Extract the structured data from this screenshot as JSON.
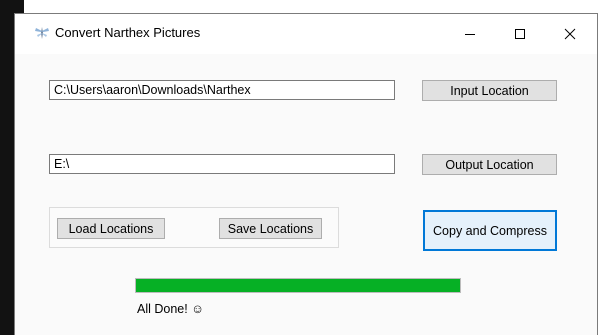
{
  "window": {
    "title": "Convert Narthex Pictures"
  },
  "input_path": {
    "value": "C:\\Users\\aaron\\Downloads\\Narthex"
  },
  "output_path": {
    "value": "E:\\"
  },
  "buttons": {
    "input_location": "Input Location",
    "output_location": "Output Location",
    "load_locations": "Load Locations",
    "save_locations": "Save Locations",
    "copy_and_compress": "Copy and Compress"
  },
  "progress": {
    "percent": 100,
    "color": "#06b025"
  },
  "status": {
    "text": "All Done! ☺"
  },
  "icons": {
    "app": "dragonfly-icon",
    "minimize": "minimize-icon",
    "maximize": "maximize-icon",
    "close": "close-icon"
  }
}
